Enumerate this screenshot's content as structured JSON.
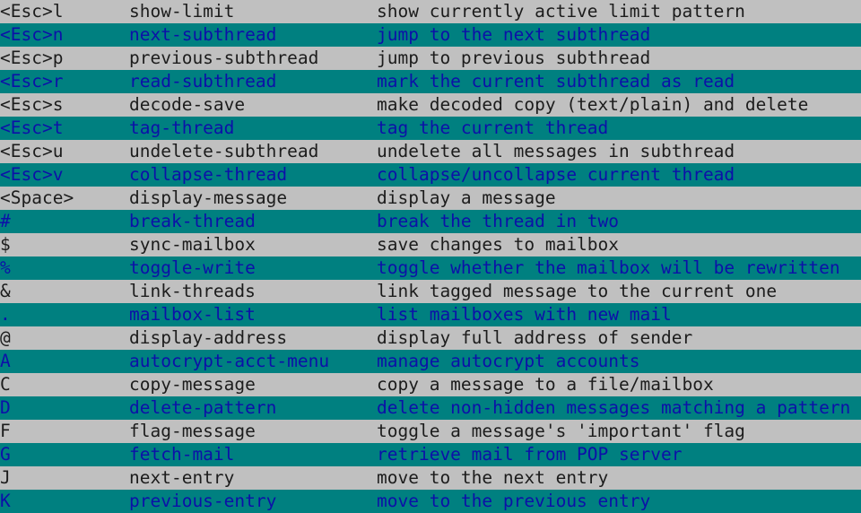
{
  "colors": {
    "row_plain_bg": "#c0c0c0",
    "row_plain_text": "#1c1c1c",
    "row_highlight_bg": "#008080",
    "row_highlight_text": "#0c10a8"
  },
  "bindings": [
    {
      "key": "<Esc>l",
      "function": "show-limit",
      "description": "show currently active limit pattern"
    },
    {
      "key": "<Esc>n",
      "function": "next-subthread",
      "description": "jump to the next subthread"
    },
    {
      "key": "<Esc>p",
      "function": "previous-subthread",
      "description": "jump to previous subthread"
    },
    {
      "key": "<Esc>r",
      "function": "read-subthread",
      "description": "mark the current subthread as read"
    },
    {
      "key": "<Esc>s",
      "function": "decode-save",
      "description": "make decoded copy (text/plain) and delete"
    },
    {
      "key": "<Esc>t",
      "function": "tag-thread",
      "description": "tag the current thread"
    },
    {
      "key": "<Esc>u",
      "function": "undelete-subthread",
      "description": "undelete all messages in subthread"
    },
    {
      "key": "<Esc>v",
      "function": "collapse-thread",
      "description": "collapse/uncollapse current thread"
    },
    {
      "key": "<Space>",
      "function": "display-message",
      "description": "display a message"
    },
    {
      "key": "#",
      "function": "break-thread",
      "description": "break the thread in two"
    },
    {
      "key": "$",
      "function": "sync-mailbox",
      "description": "save changes to mailbox"
    },
    {
      "key": "%",
      "function": "toggle-write",
      "description": "toggle whether the mailbox will be rewritten"
    },
    {
      "key": "&",
      "function": "link-threads",
      "description": "link tagged message to the current one"
    },
    {
      "key": ".",
      "function": "mailbox-list",
      "description": "list mailboxes with new mail"
    },
    {
      "key": "@",
      "function": "display-address",
      "description": "display full address of sender"
    },
    {
      "key": "A",
      "function": "autocrypt-acct-menu",
      "description": "manage autocrypt accounts"
    },
    {
      "key": "C",
      "function": "copy-message",
      "description": "copy a message to a file/mailbox"
    },
    {
      "key": "D",
      "function": "delete-pattern",
      "description": "delete non-hidden messages matching a pattern"
    },
    {
      "key": "F",
      "function": "flag-message",
      "description": "toggle a message's 'important' flag"
    },
    {
      "key": "G",
      "function": "fetch-mail",
      "description": "retrieve mail from POP server"
    },
    {
      "key": "J",
      "function": "next-entry",
      "description": "move to the next entry"
    },
    {
      "key": "K",
      "function": "previous-entry",
      "description": "move to the previous entry"
    }
  ]
}
